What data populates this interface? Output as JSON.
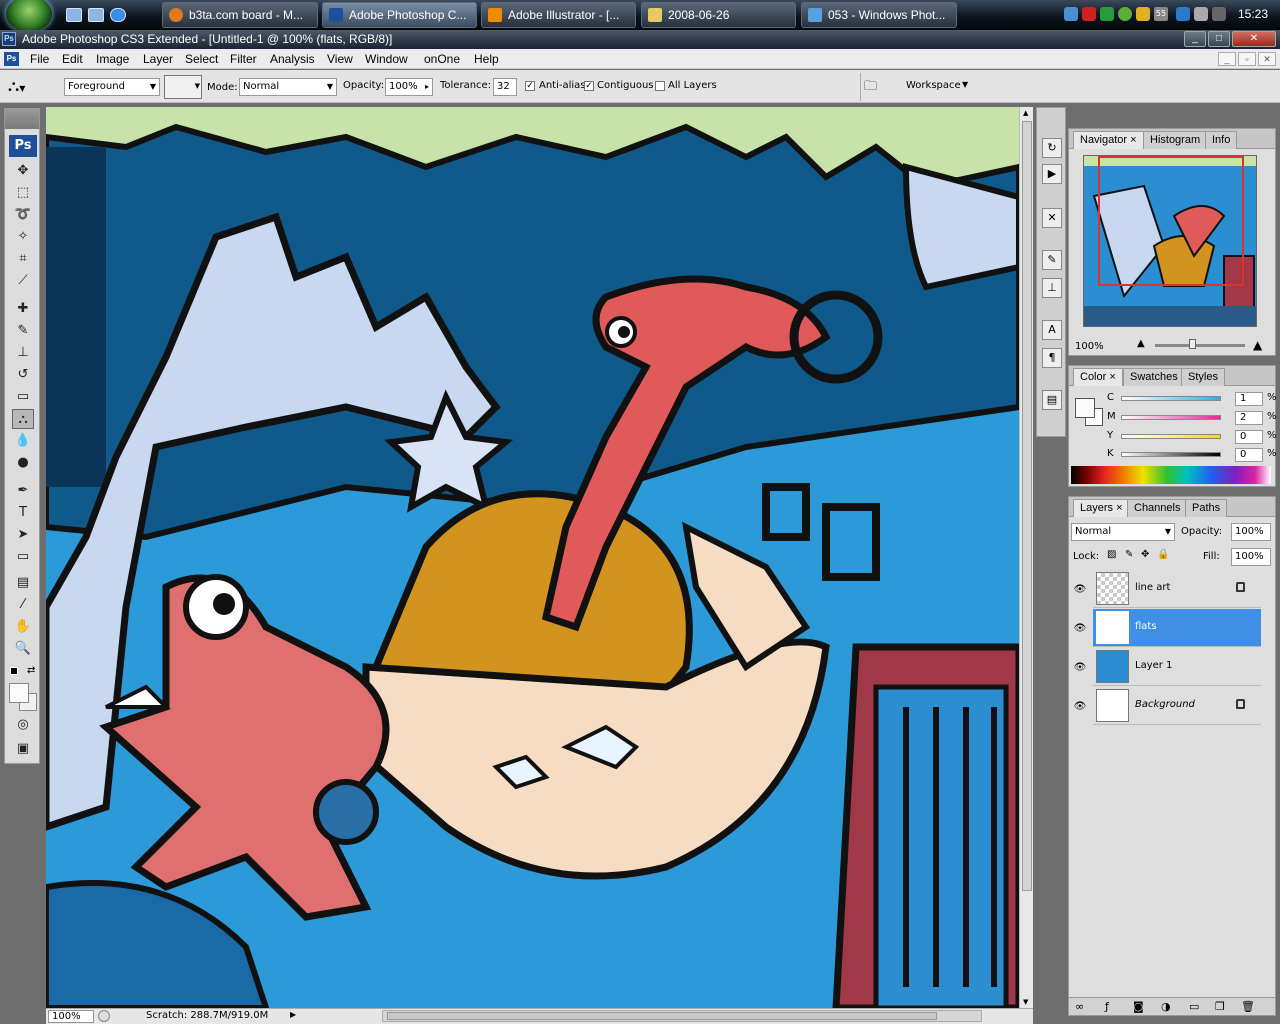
{
  "taskbar": {
    "buttons": [
      {
        "label": "b3ta.com board - M..."
      },
      {
        "label": "Adobe Photoshop C..."
      },
      {
        "label": "Adobe Illustrator - [..."
      },
      {
        "label": "2008-06-26"
      },
      {
        "label": "053 - Windows Phot..."
      }
    ],
    "tray_text": "55",
    "clock": "15:23"
  },
  "window": {
    "title": "Adobe Photoshop CS3 Extended - [Untitled-1 @ 100% (flats, RGB/8)]"
  },
  "menus": [
    "File",
    "Edit",
    "Image",
    "Layer",
    "Select",
    "Filter",
    "Analysis",
    "View",
    "Window",
    "onOne",
    "Help"
  ],
  "options": {
    "fill": "Foreground",
    "mode_label": "Mode:",
    "mode": "Normal",
    "opacity_label": "Opacity:",
    "opacity": "100%",
    "tolerance_label": "Tolerance:",
    "tolerance": "32",
    "anti_alias": "Anti-alias",
    "contiguous": "Contiguous",
    "all_layers": "All Layers",
    "workspace": "Workspace"
  },
  "toolbox": {
    "logo": "Ps"
  },
  "status": {
    "zoom": "100%",
    "scratch": "Scratch: 288.7M/919.0M"
  },
  "navigator": {
    "tabs": [
      "Navigator",
      "Histogram",
      "Info"
    ],
    "zoom": "100%"
  },
  "color_panel": {
    "tabs": [
      "Color",
      "Swatches",
      "Styles"
    ],
    "channels": [
      {
        "k": "C",
        "val": "1"
      },
      {
        "k": "M",
        "val": "2"
      },
      {
        "k": "Y",
        "val": "0"
      },
      {
        "k": "K",
        "val": "0"
      }
    ],
    "pct": "%"
  },
  "layers_panel": {
    "tabs": [
      "Layers",
      "Channels",
      "Paths"
    ],
    "blend": "Normal",
    "opacity_label": "Opacity:",
    "opacity": "100%",
    "lock_label": "Lock:",
    "fill_label": "Fill:",
    "fill": "100%",
    "layers": [
      {
        "name": "line art"
      },
      {
        "name": "flats"
      },
      {
        "name": "Layer 1"
      },
      {
        "name": "Background"
      }
    ]
  },
  "colors": {
    "accent": "#3f8fe6",
    "canvas_bg": "#1e8bd0"
  }
}
